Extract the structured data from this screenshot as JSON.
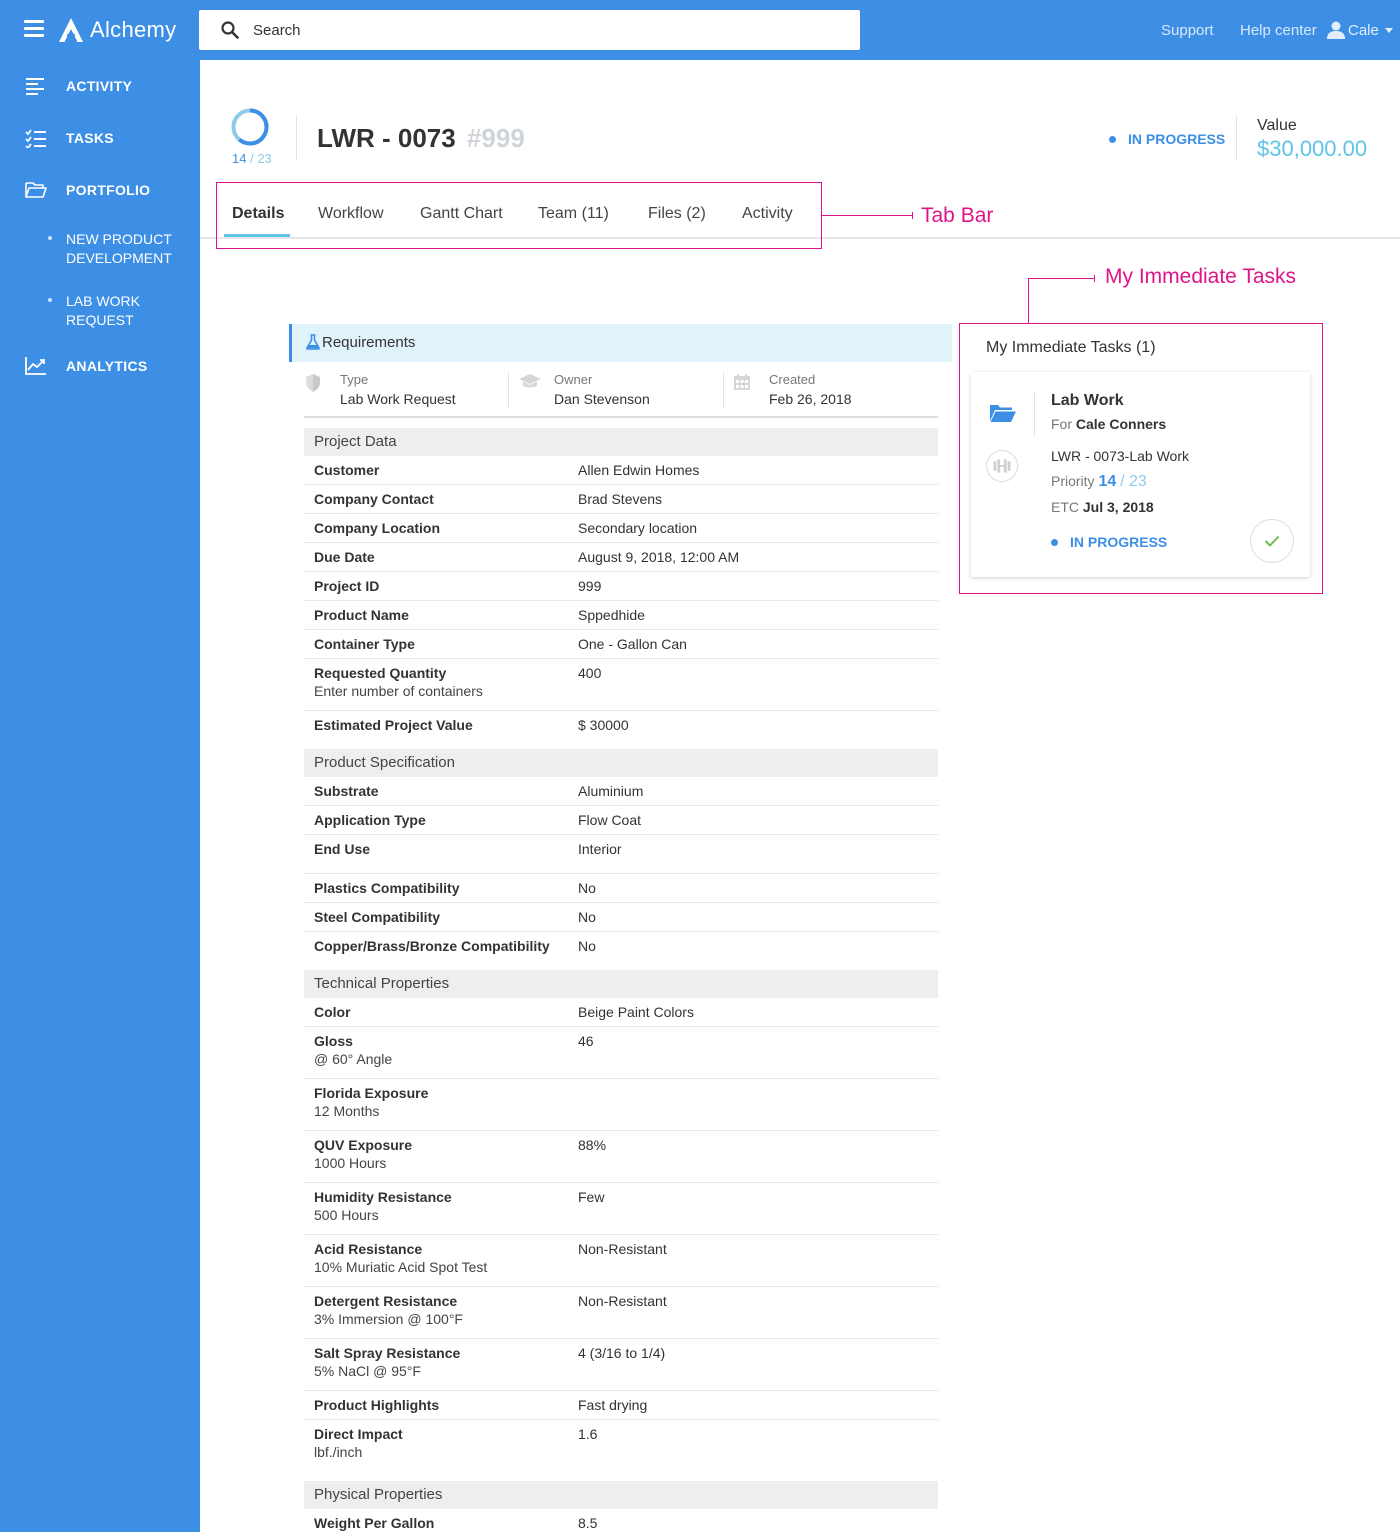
{
  "app": {
    "name": "Alchemy"
  },
  "search": {
    "placeholder": "Search"
  },
  "topnav": {
    "support": "Support",
    "help_center": "Help center",
    "user": "Cale"
  },
  "sidebar": {
    "activity": "ACTIVITY",
    "tasks": "TASKS",
    "portfolio": "PORTFOLIO",
    "sub1": "NEW PRODUCT DEVELOPMENT",
    "sub2": "LAB WORK REQUEST",
    "analytics": "ANALYTICS"
  },
  "header": {
    "progress_done": "14",
    "progress_total": "/ 23",
    "progress_fraction": 0.61,
    "title": "LWR - 0073",
    "title_id": "#999",
    "status": "IN PROGRESS",
    "value_label": "Value",
    "value_amount": "$30,000.00"
  },
  "tabs": {
    "details": "Details",
    "workflow": "Workflow",
    "gantt": "Gantt Chart",
    "team": "Team (11)",
    "files": "Files (2)",
    "activity": "Activity"
  },
  "annotations": {
    "tab_bar": "Tab Bar",
    "my_tasks": "My Immediate Tasks"
  },
  "requirements": {
    "title": "Requirements",
    "type_label": "Type",
    "type_value": "Lab Work Request",
    "owner_label": "Owner",
    "owner_value": "Dan Stevenson",
    "created_label": "Created",
    "created_value": "Feb 26, 2018"
  },
  "sections": {
    "project_data": "Project Data",
    "product_spec": "Product Specification",
    "technical": "Technical Properties",
    "physical": "Physical Properties"
  },
  "project_data": [
    {
      "k": "Customer",
      "v": "Allen Edwin Homes"
    },
    {
      "k": "Company Contact",
      "v": "Brad Stevens"
    },
    {
      "k": "Company Location",
      "v": "Secondary location"
    },
    {
      "k": "Due Date",
      "v": "August 9, 2018, 12:00 AM"
    },
    {
      "k": "Project ID",
      "v": "999"
    },
    {
      "k": "Product Name",
      "v": "Sppedhide"
    },
    {
      "k": "Container Type",
      "v": "One - Gallon Can"
    },
    {
      "k": "Requested Quantity",
      "sub": "Enter number of containers",
      "v": "400"
    },
    {
      "k": "Estimated Project Value",
      "v": "$ 30000"
    }
  ],
  "product_spec": [
    {
      "k": "Substrate",
      "v": "Aluminium"
    },
    {
      "k": "Application Type",
      "v": "Flow Coat"
    },
    {
      "k": "End Use",
      "v": "Interior"
    },
    {
      "k": "Plastics Compatibility",
      "v": "No"
    },
    {
      "k": "Steel Compatibility",
      "v": "No"
    },
    {
      "k": "Copper/Brass/Bronze Compatibility",
      "v": "No"
    }
  ],
  "technical": [
    {
      "k": "Color",
      "v": "Beige Paint Colors"
    },
    {
      "k": "Gloss",
      "sub": "@ 60° Angle",
      "v": "46"
    },
    {
      "k": "Florida Exposure",
      "sub": "12 Months",
      "v": ""
    },
    {
      "k": "QUV Exposure",
      "sub": "1000 Hours",
      "v": "88%"
    },
    {
      "k": "Humidity Resistance",
      "sub": "500 Hours",
      "v": "Few"
    },
    {
      "k": "Acid Resistance",
      "sub": "10% Muriatic Acid Spot Test",
      "v": "Non-Resistant"
    },
    {
      "k": "Detergent Resistance",
      "sub": "3% Immersion @ 100°F",
      "v": "Non-Resistant"
    },
    {
      "k": "Salt Spray Resistance",
      "sub": "5% NaCl @ 95°F",
      "v": "4 (3/16 to 1/4)"
    },
    {
      "k": "Product Highlights",
      "v": "Fast drying"
    },
    {
      "k": "Direct Impact",
      "sub": "lbf./inch",
      "v": "1.6"
    }
  ],
  "physical": [
    {
      "k": "Weight Per Gallon",
      "v": "8.5"
    }
  ],
  "task_panel": {
    "title": "My Immediate Tasks (1)",
    "task_name": "Lab Work",
    "for_label": "For",
    "for_name": "Cale Conners",
    "ref": "LWR - 0073-Lab Work",
    "priority_label": "Priority",
    "priority_num": "14",
    "priority_total": "/ 23",
    "etc_label": "ETC",
    "etc_date": "Jul 3, 2018",
    "status": "IN PROGRESS"
  },
  "colors": {
    "primary": "#3d8fe6",
    "accent": "#5dc4e8",
    "annotation": "#e0148a",
    "success": "#6cc04a"
  }
}
